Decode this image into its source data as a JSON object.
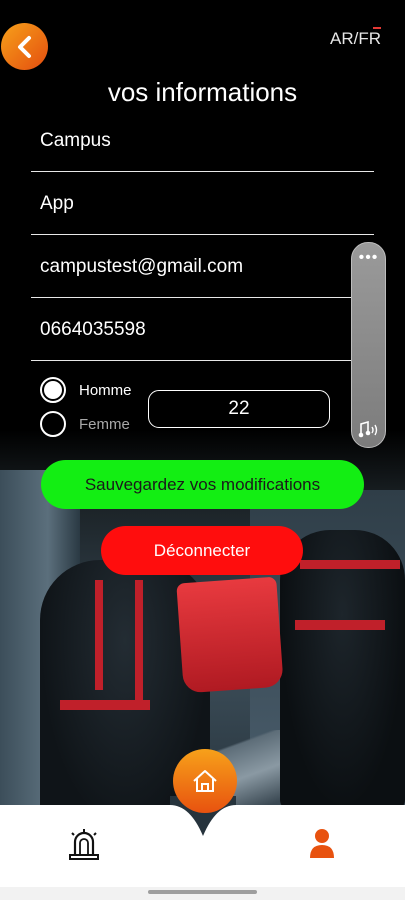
{
  "header": {
    "language_toggle": "AR/FR",
    "title": "vos informations"
  },
  "form": {
    "first_name": "Campus",
    "last_name": "App",
    "email": "campustest@gmail.com",
    "phone": "0664035598",
    "gender_options": [
      {
        "label": "Homme",
        "selected": true
      },
      {
        "label": "Femme",
        "selected": false
      }
    ],
    "age": "22"
  },
  "buttons": {
    "save_label": "Sauvegardez vos modifications",
    "logout_label": "Déconnecter"
  },
  "colors": {
    "accent_orange": "#f39b1b",
    "save_green": "#13ee13",
    "logout_red": "#ff0d0d",
    "active_profile": "#e8520f"
  },
  "nav": {
    "items": [
      {
        "icon": "alarm-icon"
      },
      {
        "icon": "home-icon"
      },
      {
        "icon": "profile-icon"
      }
    ]
  }
}
